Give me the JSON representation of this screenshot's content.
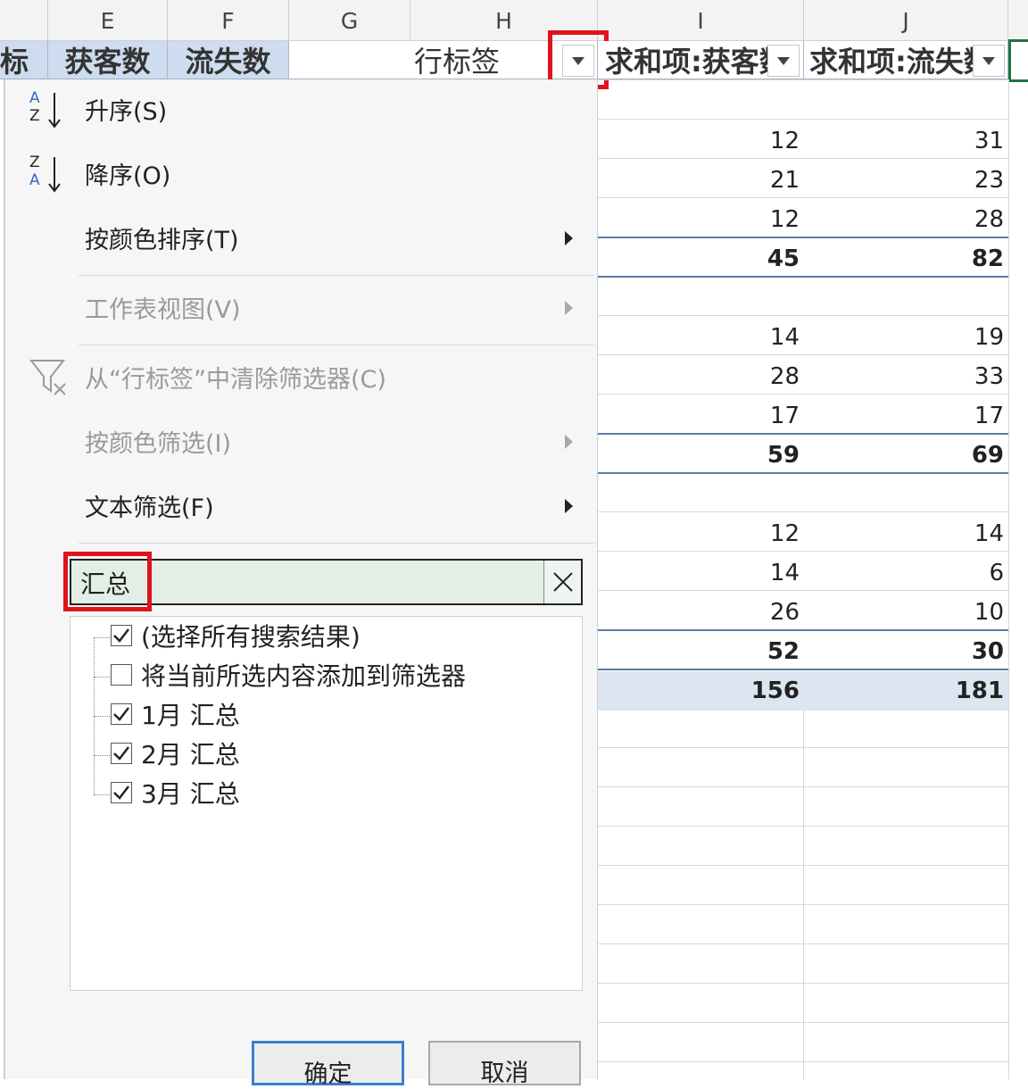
{
  "columns": {
    "E": "E",
    "F": "F",
    "G": "G",
    "H": "H",
    "I": "I",
    "J": "J"
  },
  "header_row": {
    "partial_label": "标",
    "e": "获客数",
    "f": "流失数",
    "row_labels": "行标签",
    "sum_acquired": "求和项:获客数",
    "sum_lost": "求和项:流失数"
  },
  "pivot_rows": [
    {
      "i": "12",
      "j": "31",
      "bold": false
    },
    {
      "i": "21",
      "j": "23",
      "bold": false
    },
    {
      "i": "12",
      "j": "28",
      "bold": false
    },
    {
      "i": "45",
      "j": "82",
      "bold": true
    },
    {
      "i": "14",
      "j": "19",
      "bold": false
    },
    {
      "i": "28",
      "j": "33",
      "bold": false
    },
    {
      "i": "17",
      "j": "17",
      "bold": false
    },
    {
      "i": "59",
      "j": "69",
      "bold": true
    },
    {
      "i": "12",
      "j": "14",
      "bold": false
    },
    {
      "i": "14",
      "j": "6",
      "bold": false
    },
    {
      "i": "26",
      "j": "10",
      "bold": false
    },
    {
      "i": "52",
      "j": "30",
      "bold": true
    }
  ],
  "grand_total": {
    "i": "156",
    "j": "181"
  },
  "menu": {
    "sort_asc": "升序(S)",
    "sort_desc": "降序(O)",
    "sort_by_color": "按颜色排序(T)",
    "sheet_view": "工作表视图(V)",
    "clear_filter": "从“行标签”中清除筛选器(C)",
    "filter_by_color": "按颜色筛选(I)",
    "text_filter": "文本筛选(F)"
  },
  "search": {
    "value": "汇总"
  },
  "filter_list": [
    {
      "label": "(选择所有搜索结果)",
      "checked": true
    },
    {
      "label": "将当前所选内容添加到筛选器",
      "checked": false
    },
    {
      "label": "1月 汇总",
      "checked": true
    },
    {
      "label": "2月 汇总",
      "checked": true
    },
    {
      "label": "3月 汇总",
      "checked": true
    }
  ],
  "buttons": {
    "ok": "确定",
    "cancel": "取消"
  },
  "colors": {
    "accent_red": "#e0131b",
    "header_blue": "#cdddef",
    "search_green": "#e3efe6"
  },
  "icons": [
    "sort-ascending-icon",
    "sort-descending-icon",
    "clear-filter-icon",
    "close-icon",
    "dropdown-arrow-icon",
    "submenu-arrow-icon",
    "checkmark-icon"
  ]
}
